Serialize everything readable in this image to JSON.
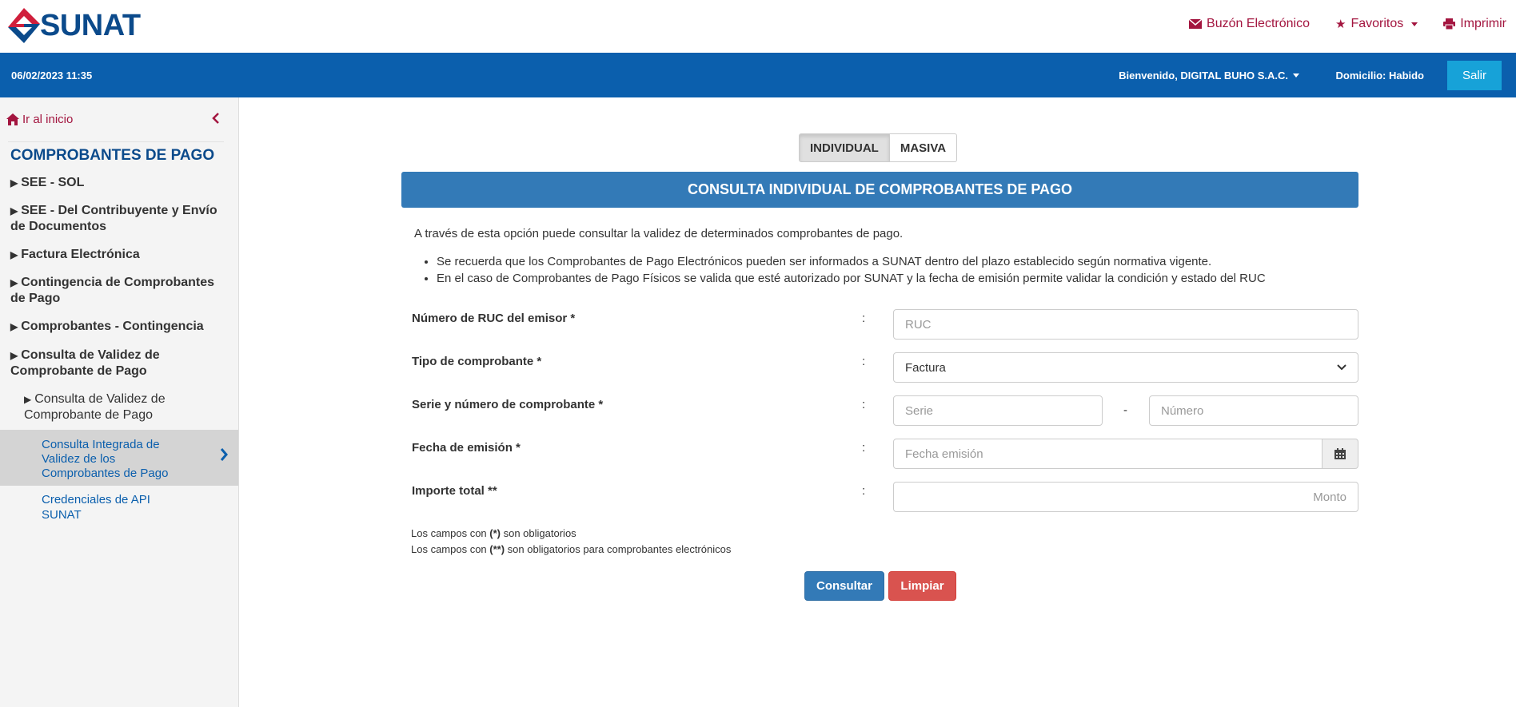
{
  "header": {
    "logo_text": "SUNAT",
    "links": {
      "mailbox": "Buzón Electrónico",
      "favorites": "Favoritos",
      "print": "Imprimir"
    }
  },
  "bar": {
    "datetime": "06/02/2023 11:35",
    "welcome": "Bienvenido, DIGITAL BUHO S.A.C.",
    "domicilio": "Domicilio: Habido",
    "logout": "Salir"
  },
  "sidebar": {
    "home": "Ir al inicio",
    "title": "COMPROBANTES DE PAGO",
    "items": [
      "SEE - SOL",
      "SEE - Del Contribuyente y Envío de Documentos",
      "Factura Electrónica",
      "Contingencia de Comprobantes de Pago",
      "Comprobantes - Contingencia",
      "Consulta de Validez de Comprobante de Pago"
    ],
    "sub_item": "Consulta de Validez de Comprobante de Pago",
    "active_link": "Consulta Integrada de Validez de los Comprobantes de Pago",
    "link2": "Credenciales de API SUNAT"
  },
  "main": {
    "tabs": [
      "INDIVIDUAL",
      "MASIVA"
    ],
    "title": "CONSULTA INDIVIDUAL DE COMPROBANTES DE PAGO",
    "intro": "A través de esta opción puede consultar la validez de determinados comprobantes de pago.",
    "bullets": [
      "Se recuerda que los Comprobantes de Pago Electrónicos pueden ser informados a SUNAT dentro del plazo establecido según normativa vigente.",
      "En el caso de Comprobantes de Pago Físicos se valida que esté autorizado por SUNAT y la fecha de emisión permite validar la condición y estado del RUC"
    ],
    "fields": {
      "ruc_label": "Número de RUC del emisor *",
      "ruc_placeholder": "RUC",
      "tipo_label": "Tipo de comprobante *",
      "tipo_value": "Factura",
      "serie_label": "Serie y número de comprobante *",
      "serie_placeholder": "Serie",
      "numero_placeholder": "Número",
      "fecha_label": "Fecha de emisión *",
      "fecha_placeholder": "Fecha emisión",
      "importe_label": "Importe total **",
      "importe_placeholder": "Monto",
      "colon": ":",
      "dash": "-"
    },
    "notes": {
      "n1_pre": "Los campos con ",
      "n1_mark": "(*)",
      "n1_post": " son obligatorios",
      "n2_pre": "Los campos con ",
      "n2_mark": "(**)",
      "n2_post": " son obligatorios para comprobantes electrónicos"
    },
    "buttons": {
      "submit": "Consultar",
      "clear": "Limpiar"
    }
  },
  "colors": {
    "brand_blue": "#0b5fad",
    "panel_blue": "#337ab7",
    "accent_red": "#a3153f",
    "danger": "#d9534f"
  }
}
